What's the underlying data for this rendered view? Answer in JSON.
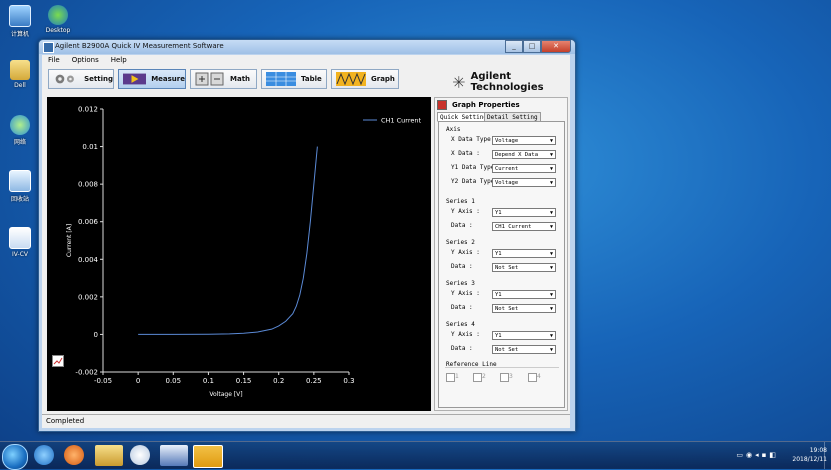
{
  "desktop": {
    "icons": [
      "计算机",
      "Desktop",
      "Dell",
      "网络",
      "回收站",
      "IV-CV"
    ]
  },
  "window": {
    "title": "Agilent B2900A Quick IV Measurement Software",
    "menu": [
      "File",
      "Options",
      "Help"
    ],
    "toolbar": [
      "Setting",
      "Measure",
      "Math",
      "Table",
      "Graph"
    ],
    "brand": "Agilent Technologies",
    "status": "Completed"
  },
  "graph_properties": {
    "title": "Graph Properties",
    "tabs": [
      "Quick Setting",
      "Detail Setting"
    ],
    "axis": {
      "section": "Axis",
      "x_data_type_label": "X Data Type :",
      "x_data_type": "Voltage",
      "x_data_label": "X Data :",
      "x_data": "Depend X Data",
      "y1_data_type_label": "Y1 Data Type :",
      "y1_data_type": "Current",
      "y2_data_type_label": "Y2 Data Type :",
      "y2_data_type": "Voltage"
    },
    "series": [
      {
        "section": "Series 1",
        "y_axis_label": "Y Axis :",
        "y_axis": "Y1",
        "data_label": "Data :",
        "data": "CH1 Current"
      },
      {
        "section": "Series 2",
        "y_axis_label": "Y Axis :",
        "y_axis": "Y1",
        "data_label": "Data :",
        "data": "Not Set"
      },
      {
        "section": "Series 3",
        "y_axis_label": "Y Axis :",
        "y_axis": "Y1",
        "data_label": "Data :",
        "data": "Not Set"
      },
      {
        "section": "Series 4",
        "y_axis_label": "Y Axis :",
        "y_axis": "Y1",
        "data_label": "Data :",
        "data": "Not Set"
      }
    ],
    "reference_line": {
      "section": "Reference Line",
      "options": [
        "1",
        "2",
        "3",
        "4"
      ]
    }
  },
  "taskbar": {
    "time": "19:08",
    "date": "2018/12/11"
  },
  "chart_data": {
    "type": "line",
    "xlabel": "Voltage [V]",
    "ylabel": "Current [A]",
    "xlim": [
      -0.05,
      0.3
    ],
    "ylim": [
      -0.002,
      0.012
    ],
    "xticks": [
      "-0.05",
      "0",
      "0.05",
      "0.1",
      "0.15",
      "0.2",
      "0.25",
      "0.3"
    ],
    "yticks": [
      "-0.002",
      "0",
      "0.002",
      "0.004",
      "0.006",
      "0.008",
      "0.01",
      "0.012"
    ],
    "grid": false,
    "legend": "top-right",
    "series": [
      {
        "name": "CH1 Current",
        "color": "#5b8ad6",
        "x": [
          0,
          0.05,
          0.1,
          0.13,
          0.15,
          0.17,
          0.19,
          0.2,
          0.21,
          0.22,
          0.225,
          0.23,
          0.235,
          0.24,
          0.245,
          0.25,
          0.255
        ],
        "y": [
          0,
          0,
          1e-05,
          3e-05,
          6e-05,
          0.00013,
          0.00028,
          0.00045,
          0.0007,
          0.0011,
          0.0015,
          0.0021,
          0.003,
          0.0043,
          0.006,
          0.008,
          0.01
        ]
      }
    ]
  }
}
